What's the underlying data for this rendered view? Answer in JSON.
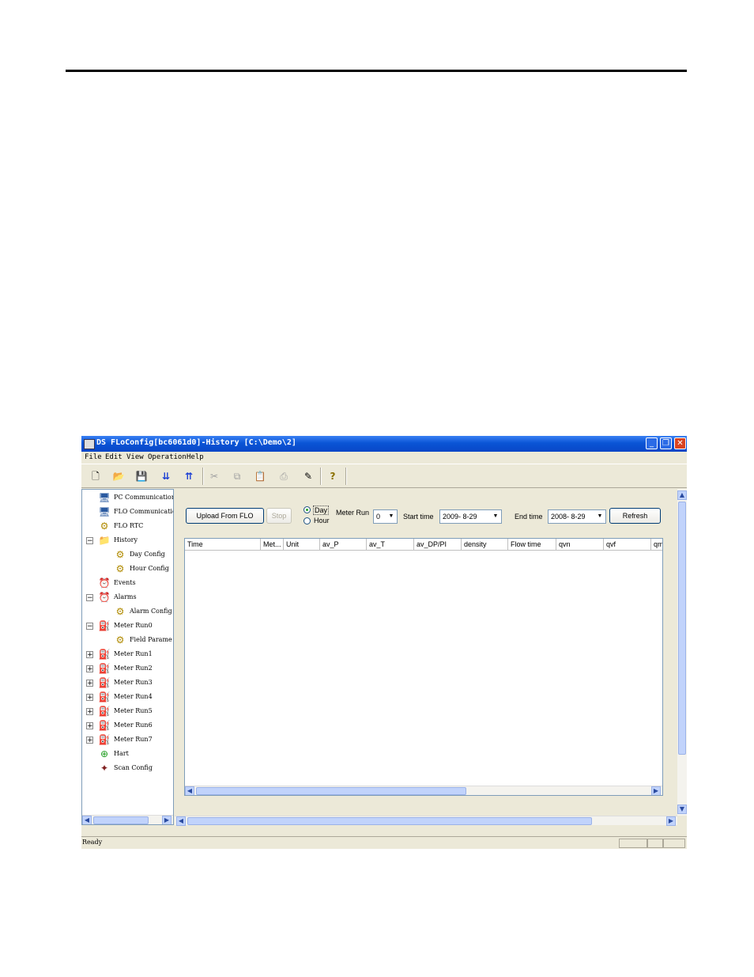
{
  "window": {
    "title": "DS FLoConfig[bc6061d0]-History [C:\\Demo\\2]",
    "controls": {
      "minimize": "_",
      "maximize": "❐",
      "close": "✕"
    }
  },
  "menu": [
    "File",
    "Edit",
    "View",
    "Operation",
    "Help"
  ],
  "toolbar": {
    "icons": [
      "new-file-icon",
      "open-folder-icon",
      "save-icon",
      "download-icon",
      "upload-icon",
      "cut-icon",
      "copy-icon",
      "paste-icon",
      "print-icon",
      "edit-icon",
      "help-icon"
    ]
  },
  "tree": [
    {
      "label": "PC Communication",
      "icon": "computer-icon"
    },
    {
      "label": "FLO Communicatio",
      "icon": "computer-icon"
    },
    {
      "label": "FLO RTC",
      "icon": "gear-icon"
    },
    {
      "label": "History",
      "icon": "folder-icon",
      "expander": "−"
    },
    {
      "label": "Day Config",
      "icon": "gear-icon"
    },
    {
      "label": "Hour Config",
      "icon": "gear-icon"
    },
    {
      "label": "Events",
      "icon": "alarm-icon"
    },
    {
      "label": "Alarms",
      "icon": "alarm-icon",
      "expander": "−"
    },
    {
      "label": "Alarm Config",
      "icon": "gear-icon"
    },
    {
      "label": "Meter Run0",
      "icon": "meter-icon",
      "expander": "−"
    },
    {
      "label": "Field Parame",
      "icon": "gear-icon"
    },
    {
      "label": "Meter Run1",
      "icon": "meter-icon",
      "expander": "+"
    },
    {
      "label": "Meter Run2",
      "icon": "meter-icon",
      "expander": "+"
    },
    {
      "label": "Meter Run3",
      "icon": "meter-icon",
      "expander": "+"
    },
    {
      "label": "Meter Run4",
      "icon": "meter-icon",
      "expander": "+"
    },
    {
      "label": "Meter Run5",
      "icon": "meter-icon",
      "expander": "+"
    },
    {
      "label": "Meter Run6",
      "icon": "meter-icon",
      "expander": "+"
    },
    {
      "label": "Meter Run7",
      "icon": "meter-icon",
      "expander": "+"
    },
    {
      "label": "Hart",
      "icon": "hart-icon"
    },
    {
      "label": "Scan Config",
      "icon": "scan-icon"
    }
  ],
  "history": {
    "upload_button": "Upload From FLO",
    "stop_button": "Stop",
    "radio_day": "Day",
    "radio_hour": "Hour",
    "selected_period": "Day",
    "meter_run_label": "Meter Run",
    "meter_run_value": "0",
    "start_time_label": "Start time",
    "start_time_value": "2009-  8-29",
    "end_time_label": "End time",
    "end_time_value": "2008-  8-29",
    "refresh_button": "Refresh",
    "columns": [
      "Time",
      "Met...",
      "Unit",
      "av_P",
      "av_T",
      "av_DP/PI",
      "density",
      "Flow time",
      "qvn",
      "qvf",
      "qm"
    ]
  },
  "status": {
    "text": "Ready"
  },
  "colors": {
    "titlebar": "#0a55d6",
    "close": "#d9431f",
    "face": "#ece9d8"
  }
}
